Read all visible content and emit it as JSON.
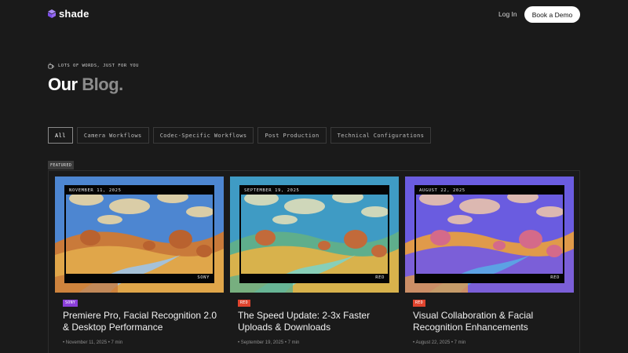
{
  "nav": {
    "brand": "shade",
    "login_label": "Log In",
    "demo_label": "Book a Demo"
  },
  "hero": {
    "eyebrow": "LOTS OF WORDS, JUST FOR YOU",
    "title_main": "Our",
    "title_accent": "Blog."
  },
  "filters": [
    {
      "label": "All",
      "active": true
    },
    {
      "label": "Camera Workflows",
      "active": false
    },
    {
      "label": "Codec-Specific Workflows",
      "active": false
    },
    {
      "label": "Post Production",
      "active": false
    },
    {
      "label": "Technical Configurations",
      "active": false
    }
  ],
  "featured_label": "FEATURED",
  "cards": [
    {
      "date_overlay": "NOVEMBER 11, 2025",
      "brand_overlay": "SONY",
      "badge": "SONY",
      "badge_color": "#8b3fd9",
      "title": "Premiere Pro, Facial Recognition 2.0 & Desktop Performance",
      "meta_date": "November 11, 2025",
      "meta_read": "7 min",
      "palette": {
        "sky": "#4d86d1",
        "cloud": "#f3d9a0",
        "hill": "#e0a64a",
        "hill2": "#c97a3a",
        "river": "#9fc4e8",
        "tree": "#b9622f"
      }
    },
    {
      "date_overlay": "SEPTEMBER 19, 2025",
      "brand_overlay": "RED",
      "badge": "RED",
      "badge_color": "#e0442e",
      "title": "The Speed Update: 2-3x Faster Uploads & Downloads",
      "meta_date": "September 19, 2025",
      "meta_read": "7 min",
      "palette": {
        "sky": "#3f9bc4",
        "cloud": "#e9e2b8",
        "hill": "#d8b24c",
        "hill2": "#5fae8c",
        "river": "#7fd1c4",
        "tree": "#c26a3a"
      }
    },
    {
      "date_overlay": "AUGUST 22, 2025",
      "brand_overlay": "RED",
      "badge": "RED",
      "badge_color": "#e0442e",
      "title": "Visual Collaboration & Facial Recognition Enhancements",
      "meta_date": "August 22, 2025",
      "meta_read": "7 min",
      "palette": {
        "sky": "#6a5ce0",
        "cloud": "#f0c8a8",
        "hill": "#7b5fd8",
        "hill2": "#e09a4a",
        "river": "#59a9e6",
        "tree": "#d46a8a"
      }
    }
  ]
}
